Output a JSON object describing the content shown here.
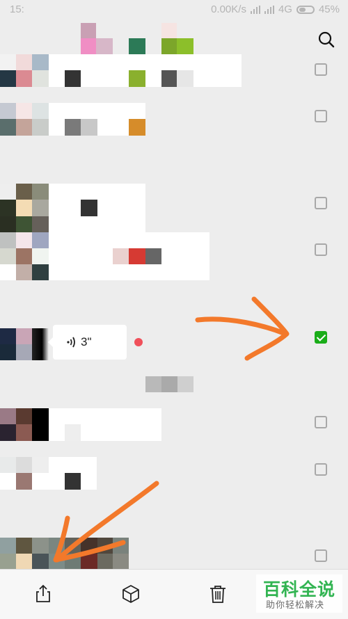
{
  "status_bar": {
    "time": "15:",
    "network_speed": "0.00K/s",
    "network_type": "4G",
    "battery": "45%"
  },
  "voice_message": {
    "duration": "3\""
  },
  "checkboxes": [
    {
      "checked": false
    },
    {
      "checked": false
    },
    {
      "checked": false
    },
    {
      "checked": false
    },
    {
      "checked": true
    },
    {
      "checked": false
    },
    {
      "checked": false
    },
    {
      "checked": false
    }
  ],
  "toolbar": {
    "share_icon": "share-icon",
    "favorite_icon": "box-icon",
    "delete_icon": "trash-icon"
  },
  "watermark": {
    "title": "百科全说",
    "subtitle": "助你轻松解决"
  },
  "colors": {
    "accent_green": "#1aad19",
    "arrow_orange": "#f3792b",
    "unread_red": "#f0505a"
  }
}
